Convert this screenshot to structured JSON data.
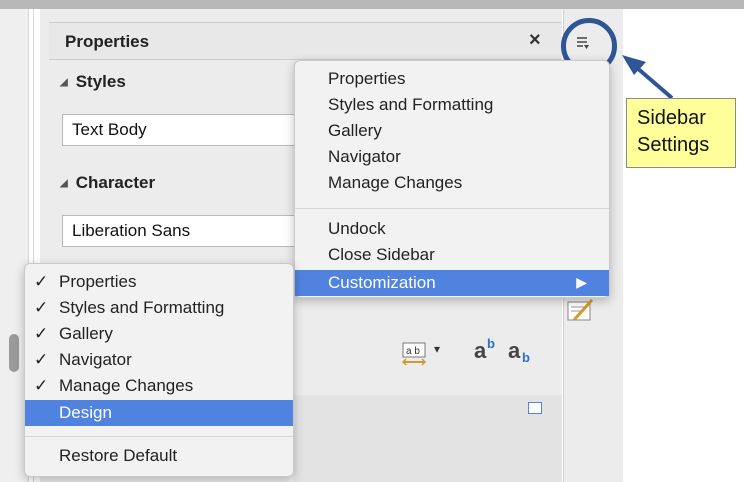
{
  "panel": {
    "title": "Properties",
    "close": "×",
    "styles_heading": "Styles",
    "style_value": "Text Body",
    "character_heading": "Character",
    "font_value": "Liberation Sans"
  },
  "deck": {
    "settings_icon": "sidebar-settings-icon"
  },
  "callout": {
    "line1": "Sidebar",
    "line2": "Settings"
  },
  "settings_menu": {
    "items": [
      "Properties",
      "Styles and Formatting",
      "Gallery",
      "Navigator",
      "Manage Changes"
    ],
    "undock": "Undock",
    "close_sidebar": "Close Sidebar",
    "customization": "Customization",
    "submenu_arrow": "▶"
  },
  "customization_menu": {
    "checkmark": "✓",
    "items": [
      "Properties",
      "Styles and Formatting",
      "Gallery",
      "Navigator",
      "Manage Changes"
    ],
    "design": "Design",
    "restore": "Restore Default"
  },
  "toolbar": {
    "char_spacing_label": "a b",
    "superscript": "a",
    "superscript_mark": "b",
    "subscript": "a",
    "subscript_mark": "b"
  },
  "colors": {
    "highlight": "#5083e0",
    "annotation": "#2f5597",
    "callout_bg": "#ffff99"
  }
}
